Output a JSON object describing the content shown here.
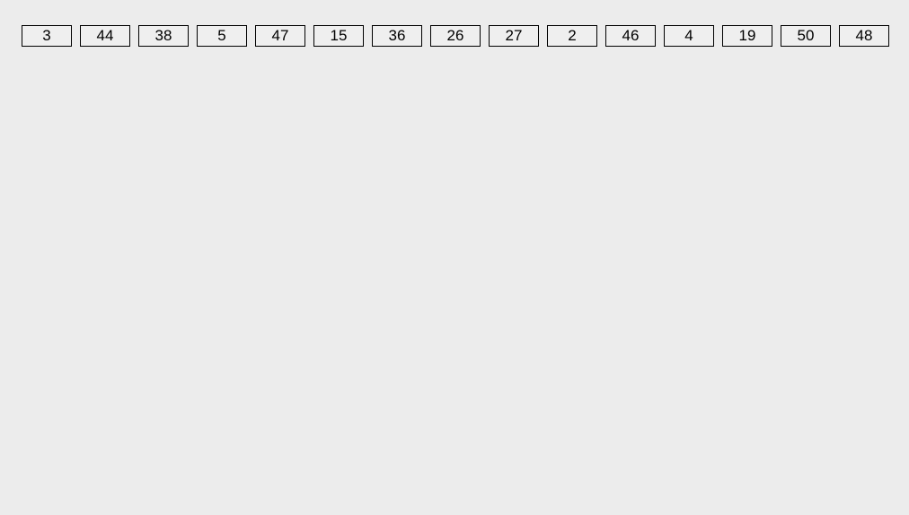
{
  "buttons": [
    {
      "label": "3"
    },
    {
      "label": "44"
    },
    {
      "label": "38"
    },
    {
      "label": "5"
    },
    {
      "label": "47"
    },
    {
      "label": "15"
    },
    {
      "label": "36"
    },
    {
      "label": "26"
    },
    {
      "label": "27"
    },
    {
      "label": "2"
    },
    {
      "label": "46"
    },
    {
      "label": "4"
    },
    {
      "label": "19"
    },
    {
      "label": "50"
    },
    {
      "label": "48"
    }
  ]
}
